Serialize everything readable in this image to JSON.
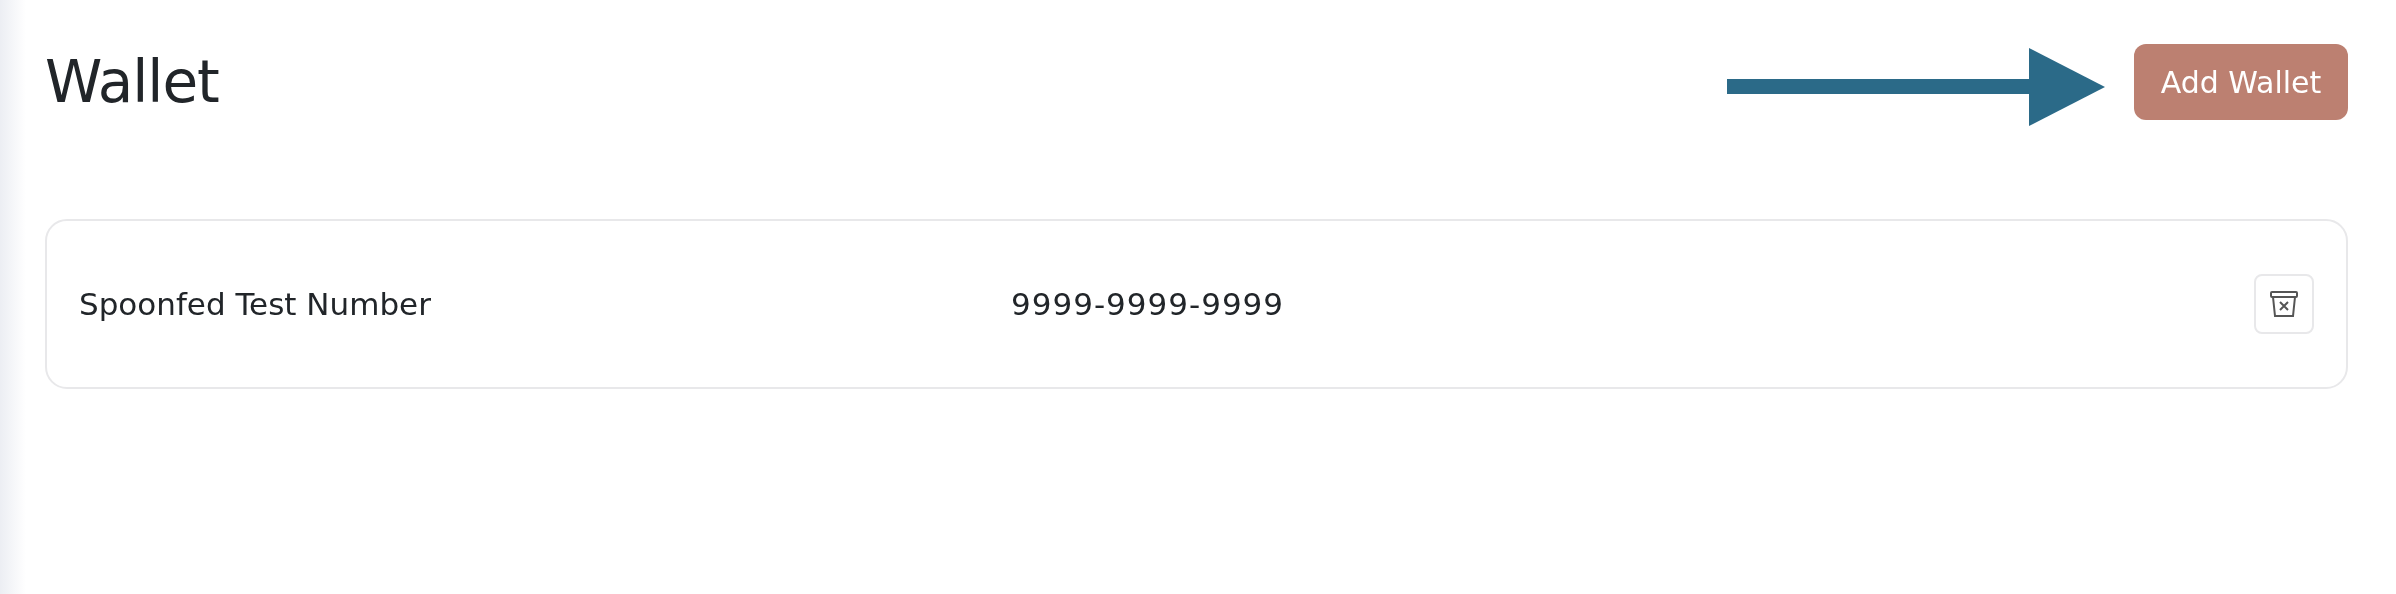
{
  "page": {
    "title": "Wallet"
  },
  "add_button": {
    "label": "Add Wallet"
  },
  "wallets": [
    {
      "name": "Spoonfed Test Number",
      "number": "9999-9999-9999"
    }
  ]
}
